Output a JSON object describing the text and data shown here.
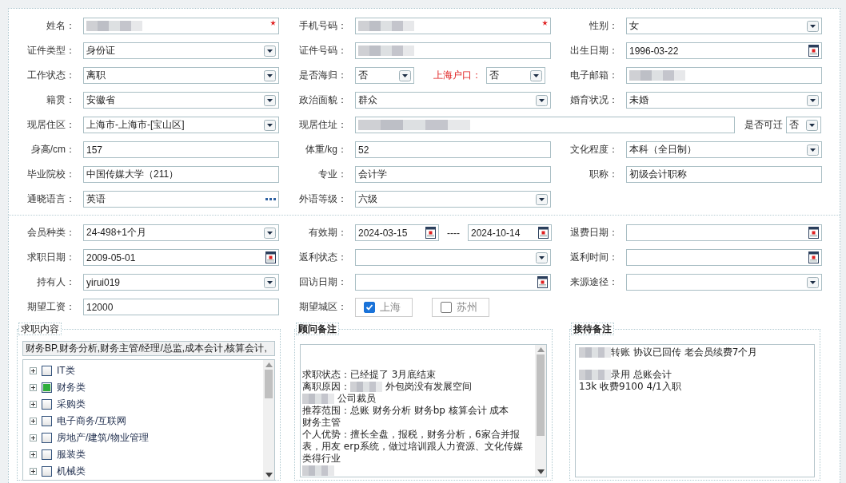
{
  "sections": [
    {
      "fields": [
        {
          "label": "姓名：",
          "kind": "text",
          "redacted": true,
          "required": true
        },
        {
          "label": "手机号码：",
          "kind": "text",
          "redacted": true,
          "required": true
        },
        {
          "label": "性别：",
          "kind": "select",
          "value": "女"
        },
        {
          "label": "证件类型：",
          "kind": "select",
          "value": "身份证"
        },
        {
          "label": "证件号码：",
          "kind": "text",
          "redacted": true
        },
        {
          "label": "出生日期：",
          "kind": "date",
          "value": "1996-03-22"
        },
        {
          "label": "工作状态：",
          "kind": "select",
          "value": "离职"
        },
        {
          "label": "是否海归：",
          "kind": "pair",
          "value": "否",
          "extra": {
            "label": "上海户口：",
            "value": "否"
          }
        },
        {
          "label": "电子邮箱：",
          "kind": "text",
          "redacted": true
        },
        {
          "label": "籍贯：",
          "kind": "select",
          "value": "安徽省"
        },
        {
          "label": "政治面貌：",
          "kind": "select",
          "value": "群众"
        },
        {
          "label": "婚育状况：",
          "kind": "select",
          "value": "未婚"
        },
        {
          "label": "现居住区：",
          "kind": "select",
          "value": "上海市-上海市-[宝山区]"
        },
        {
          "label": "现居住址：",
          "kind": "address",
          "redacted": true,
          "extra": {
            "label": "是否可迁",
            "value": "否"
          }
        },
        {
          "label": "身高/cm：",
          "kind": "text",
          "value": "157"
        },
        {
          "label": "体重/kg：",
          "kind": "text",
          "value": "52"
        },
        {
          "label": "文化程度：",
          "kind": "select",
          "value": "本科（全日制）"
        },
        {
          "label": "毕业院校：",
          "kind": "text",
          "value": "中国传媒大学（211）"
        },
        {
          "label": "专业：",
          "kind": "text",
          "value": "会计学"
        },
        {
          "label": "职称：",
          "kind": "text",
          "value": "初级会计职称"
        },
        {
          "label": "通晓语言：",
          "kind": "lookup",
          "value": "英语"
        },
        {
          "label": "外语等级：",
          "kind": "select",
          "value": "六级"
        }
      ]
    },
    {
      "fields": [
        {
          "label": "会员种类：",
          "kind": "select",
          "value": "24-498+1个月"
        },
        {
          "label": "有效期：",
          "kind": "range",
          "from": "2024-03-15",
          "separator": "----",
          "to": "2024-10-14"
        },
        {
          "label": "退费日期：",
          "kind": "date"
        },
        {
          "label": "求职日期：",
          "kind": "date",
          "value": "2009-05-01"
        },
        {
          "label": "返利状态：",
          "kind": "select"
        },
        {
          "label": "返利时间：",
          "kind": "date"
        },
        {
          "label": "持有人：",
          "kind": "select",
          "value": "yirui019"
        },
        {
          "label": "回访日期：",
          "kind": "date"
        },
        {
          "label": "来源途径：",
          "kind": "select"
        },
        {
          "label": "期望工资：",
          "kind": "text",
          "value": "12000"
        },
        {
          "label": "期望城区：",
          "kind": "checks",
          "options": [
            {
              "label": "上海",
              "checked": true
            },
            {
              "label": "苏州",
              "checked": false
            }
          ]
        }
      ]
    }
  ],
  "job_content": {
    "legend": "求职内容",
    "summary": "财务BP,财务分析,财务主管/经理/总监,成本会计,核算会计,",
    "items": [
      {
        "label": "IT类",
        "checked": false
      },
      {
        "label": "财务类",
        "checked": true
      },
      {
        "label": "采购类",
        "checked": false
      },
      {
        "label": "电子商务/互联网",
        "checked": false
      },
      {
        "label": "房地产/建筑/物业管理",
        "checked": false
      },
      {
        "label": "服装类",
        "checked": false
      },
      {
        "label": "机械类",
        "checked": false
      }
    ]
  },
  "advisor_notes": {
    "legend": "顾问备注",
    "lines": [
      {
        "text": "求职状态：已经提了 3月底结束",
        "blurred": false
      },
      {
        "text": " 外包岗没有发展空间",
        "prefix": "离职原因：",
        "blurred": true
      },
      {
        "text": " 公司裁员",
        "blurred": true
      },
      {
        "text": "推荐范围：总账 财务分析  财务bp 核算会计 成本",
        "blurred": false
      },
      {
        "text": "财务主管",
        "blurred": false
      },
      {
        "text": "个人优势：擅长全盘，报税，财务分析，6家合并报",
        "blurred": false
      },
      {
        "text": "表，用友 erp系统，做过培训跟人力资源、文化传媒",
        "blurred": false
      },
      {
        "text": "类得行业",
        "blurred": false
      },
      {
        "blurred": true
      }
    ]
  },
  "reception_notes": {
    "legend": "接待备注",
    "paragraphs": [
      [
        {
          "text": "转账 协议已回传 老会员续费7个月",
          "blurred": true
        }
      ],
      [
        {
          "text": "录用 总账会计",
          "blurred": true
        },
        {
          "text": "13k  收费9100  4/1入职",
          "blurred": false
        }
      ]
    ]
  }
}
